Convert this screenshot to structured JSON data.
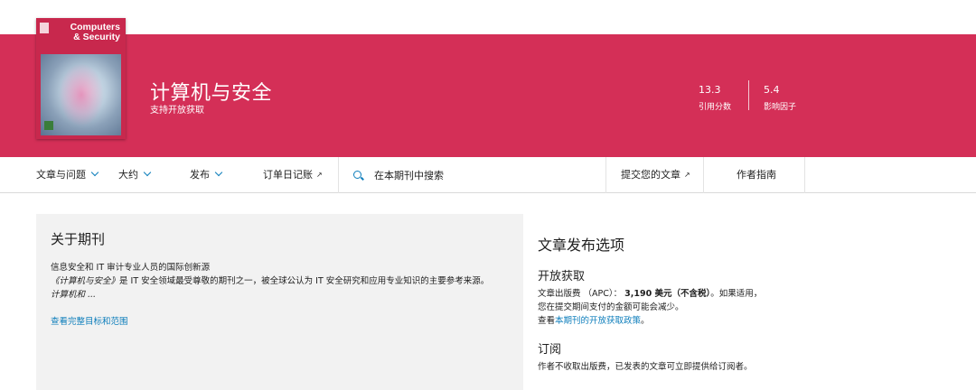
{
  "cover": {
    "title_line1": "Computers",
    "title_line2": "& Security"
  },
  "banner": {
    "title": "计算机与安全",
    "subtitle": "支持开放获取",
    "background_color": "#d42f57",
    "metrics": [
      {
        "value": "13.3",
        "label": "引用分数"
      },
      {
        "value": "5.4",
        "label": "影响因子"
      }
    ]
  },
  "nav": {
    "items": [
      {
        "label": "文章与问题",
        "icon": "chevron-down-icon"
      },
      {
        "label": "大约",
        "icon": "chevron-down-icon"
      },
      {
        "label": "发布",
        "icon": "chevron-down-icon"
      },
      {
        "label": "订单日记账",
        "icon": "external-link-icon"
      }
    ],
    "search_placeholder": "在本期刊中搜索",
    "submit_label": "提交您的文章",
    "guide_label": "作者指南",
    "link_color": "#0c7dbb"
  },
  "about": {
    "heading": "关于期刊",
    "line1": "信息安全和 IT 审计专业人员的国际创新源",
    "journal_name": "《计算机与安全》",
    "line2": "是 IT 安全领域最受尊敬的期刊之一，被全球公认为 IT 安全研究和应用专业知识的主要参考来源。",
    "excerpt": "计算机和 ...",
    "more_link": "查看完整目标和范围"
  },
  "publishing": {
    "heading": "文章发布选项",
    "open_access": {
      "heading": "开放获取",
      "apc_prefix": "文章出版费 （APC）： ",
      "apc_value": "3,190 美元（不含税）",
      "apc_suffix": "。如果适用，",
      "line2": "您在提交期间支付的金额可能会减少。",
      "policy_prefix": "查看",
      "policy_link": "本期刊的开放获取政策",
      "policy_suffix": "。"
    },
    "subscription": {
      "heading": "订阅",
      "text": "作者不收取出版费，已发表的文章可立即提供给订阅者。"
    }
  }
}
